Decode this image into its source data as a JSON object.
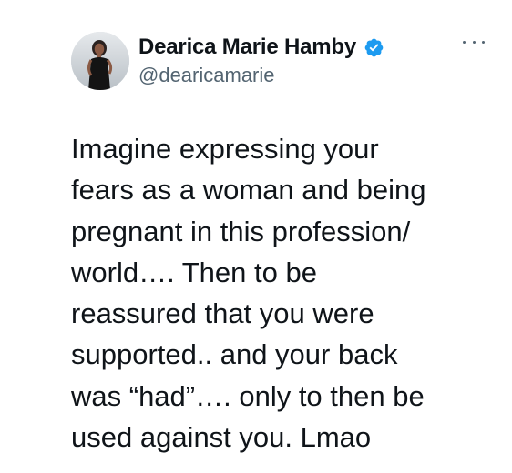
{
  "author": {
    "display_name": "Dearica Marie Hamby",
    "handle": "@dearicamarie",
    "verified": true,
    "avatar_icon": "profile-photo",
    "verified_badge_color": "#1d9bf0"
  },
  "menu": {
    "more_icon": "ellipsis-icon"
  },
  "tweet": {
    "text": "Imagine expressing your\nfears as a woman and being\npregnant in this profession/\nworld…. Then to be\nreassured that you were\nsupported.. and your back\nwas “had”…. only to then be\nused against you. Lmao"
  },
  "colors": {
    "text_primary": "#0f1419",
    "text_secondary": "#536471",
    "accent": "#1d9bf0"
  }
}
